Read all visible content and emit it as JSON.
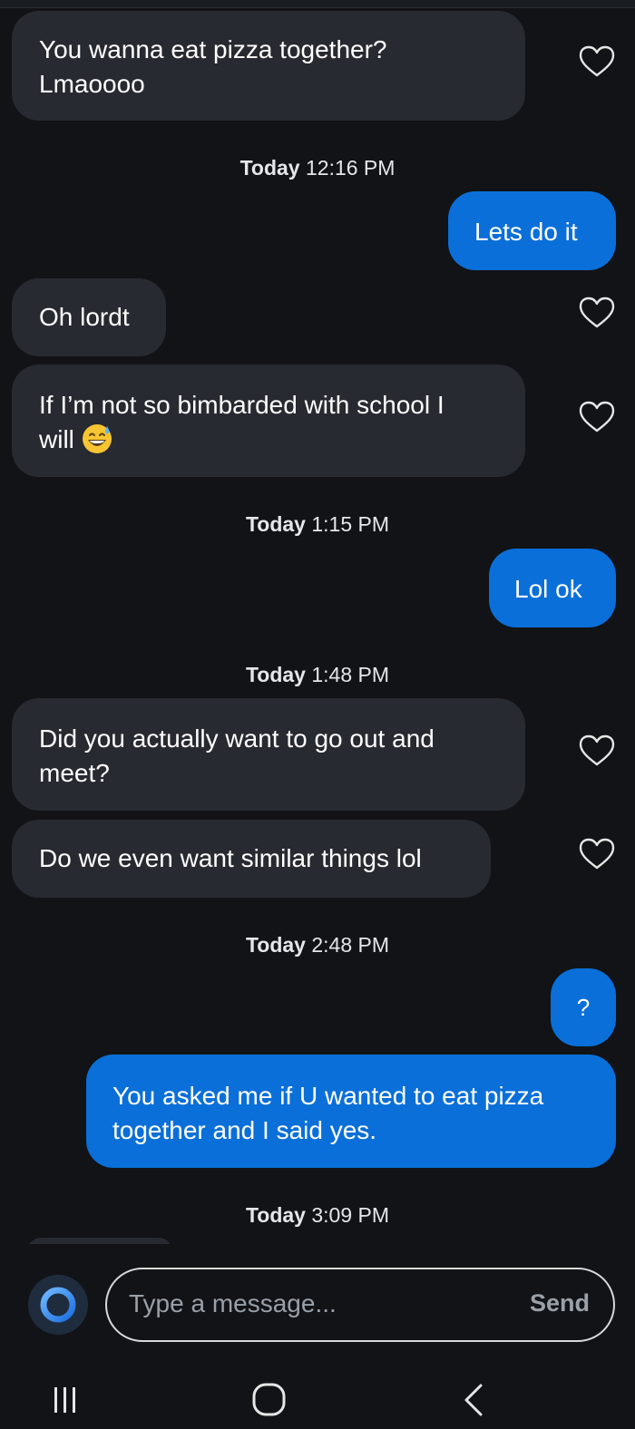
{
  "messages": [
    {
      "text_line1": "You wanna eat pizza together?",
      "text_line2": "Lmaoooo"
    },
    {
      "day": "Today",
      "time": "12:16 PM"
    },
    {
      "text": "Lets do it"
    },
    {
      "text": "Oh lordt"
    },
    {
      "text_line1": "If I’m not so bimbarded with school I",
      "text_line2": "will",
      "emoji": "grinning-face-with-sweat"
    },
    {
      "day": "Today",
      "time": "1:15 PM"
    },
    {
      "text": "Lol ok"
    },
    {
      "day": "Today",
      "time": "1:48 PM"
    },
    {
      "text_line1": "Did you actually want to go out and",
      "text_line2": "meet?"
    },
    {
      "text": "Do we even want similar things lol"
    },
    {
      "day": "Today",
      "time": "2:48 PM"
    },
    {
      "text": "?"
    },
    {
      "text_line1": "You asked me if U wanted to eat pizza",
      "text_line2": "together and I said yes."
    },
    {
      "day": "Today",
      "time": "3:09 PM"
    }
  ],
  "composer": {
    "placeholder": "Type a message...",
    "send_label": "Send"
  },
  "icons": {
    "like": "heart-outline-icon",
    "assistant": "ring-icon",
    "recents": "recents-icon",
    "home": "home-icon",
    "back": "back-icon"
  },
  "colors": {
    "background": "#111317",
    "incoming_bubble": "#272a30",
    "outgoing_bubble": "#0a6fd8",
    "text": "#ffffff",
    "muted": "#9aa0a8"
  }
}
